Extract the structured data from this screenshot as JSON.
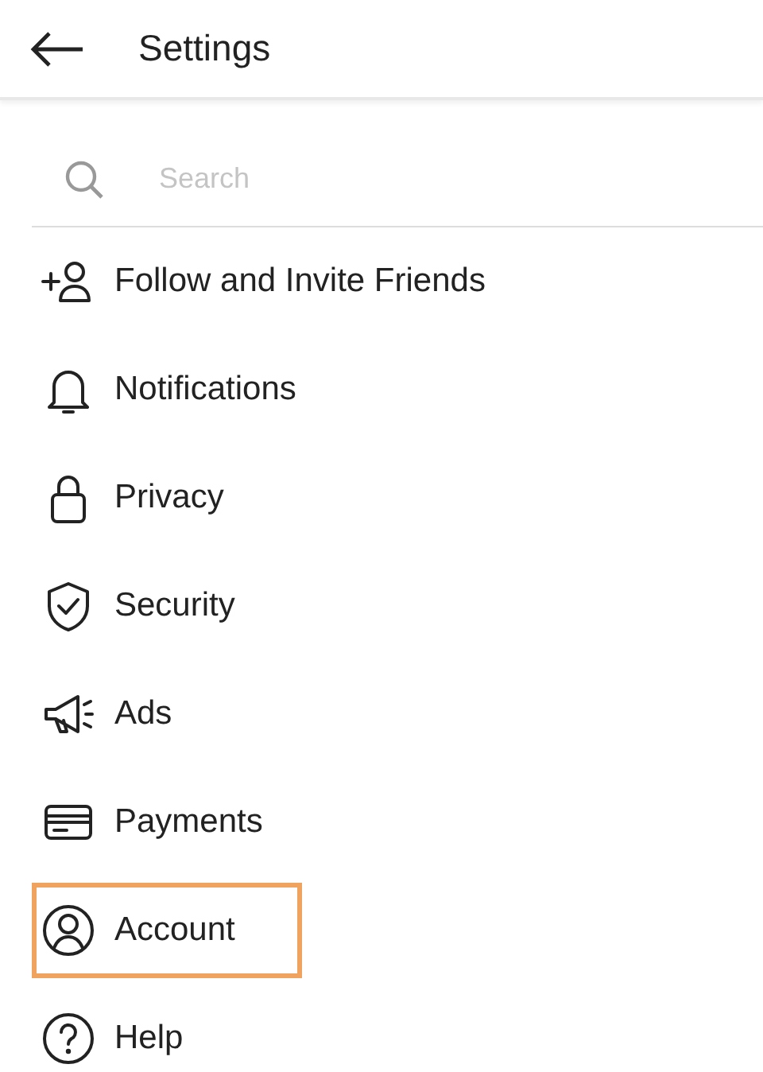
{
  "header": {
    "title": "Settings"
  },
  "search": {
    "placeholder": "Search"
  },
  "items": [
    {
      "kind": "follow",
      "label": "Follow and Invite Friends",
      "highlighted": false
    },
    {
      "kind": "bell",
      "label": "Notifications",
      "highlighted": false
    },
    {
      "kind": "lock",
      "label": "Privacy",
      "highlighted": false
    },
    {
      "kind": "shield",
      "label": "Security",
      "highlighted": false
    },
    {
      "kind": "megaphone",
      "label": "Ads",
      "highlighted": false
    },
    {
      "kind": "card",
      "label": "Payments",
      "highlighted": false
    },
    {
      "kind": "account",
      "label": "Account",
      "highlighted": true
    },
    {
      "kind": "help",
      "label": "Help",
      "highlighted": false
    }
  ]
}
